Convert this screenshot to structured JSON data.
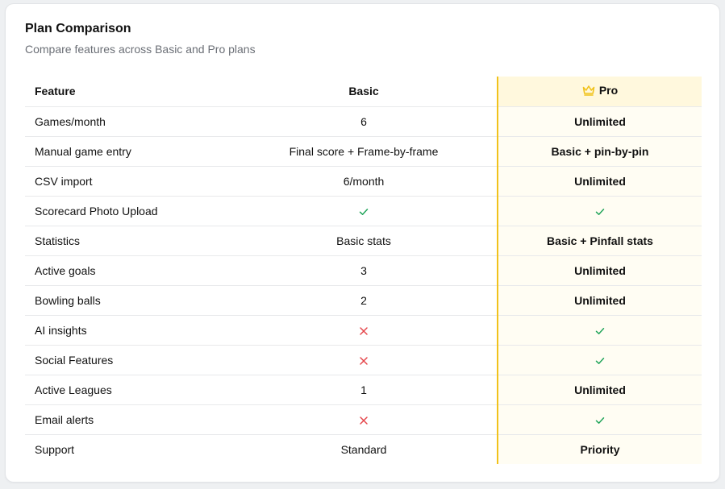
{
  "header": {
    "title": "Plan Comparison",
    "subtitle": "Compare features across Basic and Pro plans"
  },
  "table": {
    "columns": {
      "feature": "Feature",
      "basic": "Basic",
      "pro": "Pro"
    },
    "rows": [
      {
        "feature": "Games/month",
        "basic": "6",
        "pro": "Unlimited"
      },
      {
        "feature": "Manual game entry",
        "basic": "Final score + Frame-by-frame",
        "pro": "Basic + pin-by-pin"
      },
      {
        "feature": "CSV import",
        "basic": "6/month",
        "pro": "Unlimited"
      },
      {
        "feature": "Scorecard Photo Upload",
        "basic": "check-icon",
        "pro": "check-icon"
      },
      {
        "feature": "Statistics",
        "basic": "Basic stats",
        "pro": "Basic + Pinfall stats"
      },
      {
        "feature": "Active goals",
        "basic": "3",
        "pro": "Unlimited"
      },
      {
        "feature": "Bowling balls",
        "basic": "2",
        "pro": "Unlimited"
      },
      {
        "feature": "AI insights",
        "basic": "cross-icon",
        "pro": "check-icon"
      },
      {
        "feature": "Social Features",
        "basic": "cross-icon",
        "pro": "check-icon"
      },
      {
        "feature": "Active Leagues",
        "basic": "1",
        "pro": "Unlimited"
      },
      {
        "feature": "Email alerts",
        "basic": "cross-icon",
        "pro": "check-icon"
      },
      {
        "feature": "Support",
        "basic": "Standard",
        "pro": "Priority"
      }
    ]
  },
  "icons": {
    "pro_header": "crown-icon"
  },
  "colors": {
    "accent": "#f1c21b",
    "check": "#22a55b",
    "cross": "#e5484d",
    "pro_bg": "#fffdf3",
    "pro_header_bg": "#fff8dd"
  }
}
